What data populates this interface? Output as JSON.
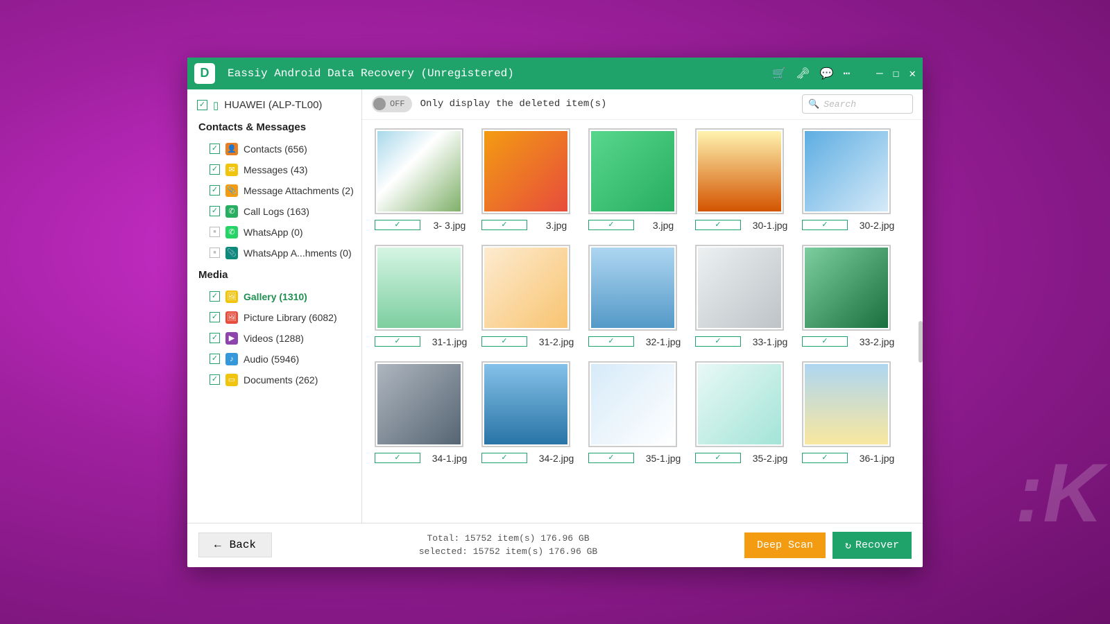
{
  "titlebar": {
    "title": "Eassiy Android Data Recovery (Unregistered)",
    "logo": "D"
  },
  "device": {
    "name": "HUAWEI (ALP-TL00)"
  },
  "sidebar": {
    "group1_title": "Contacts & Messages",
    "group2_title": "Media",
    "items1": [
      {
        "label": "Contacts (656)",
        "color": "#e67e22",
        "glyph": "👤",
        "chk": "checked"
      },
      {
        "label": "Messages (43)",
        "color": "#f1c40f",
        "glyph": "✉",
        "chk": "checked"
      },
      {
        "label": "Message Attachments (2)",
        "color": "#f39c12",
        "glyph": "📎",
        "chk": "checked"
      },
      {
        "label": "Call Logs (163)",
        "color": "#27ae60",
        "glyph": "✆",
        "chk": "checked"
      },
      {
        "label": "WhatsApp (0)",
        "color": "#25d366",
        "glyph": "✆",
        "chk": "gray"
      },
      {
        "label": "WhatsApp A...hments (0)",
        "color": "#0b8a7a",
        "glyph": "📎",
        "chk": "gray"
      }
    ],
    "items2": [
      {
        "label": "Gallery (1310)",
        "color": "#f1c40f",
        "glyph": "🖼",
        "chk": "checked",
        "active": true
      },
      {
        "label": "Picture Library (6082)",
        "color": "#e74c3c",
        "glyph": "🖼",
        "chk": "checked"
      },
      {
        "label": "Videos (1288)",
        "color": "#8e44ad",
        "glyph": "▶",
        "chk": "checked"
      },
      {
        "label": "Audio (5946)",
        "color": "#3498db",
        "glyph": "♪",
        "chk": "checked"
      },
      {
        "label": "Documents (262)",
        "color": "#f1c40f",
        "glyph": "▭",
        "chk": "checked"
      }
    ]
  },
  "toolbar": {
    "toggle_state": "OFF",
    "toggle_label": "Only display the deleted item(s)",
    "search_placeholder": "Search"
  },
  "gallery": [
    {
      "name": "3- 3.jpg",
      "bg": "linear-gradient(135deg,#a8d8ea,#ffffff 40%,#7fb069)"
    },
    {
      "name": "3.jpg",
      "bg": "linear-gradient(135deg,#f39c12,#e74c3c)"
    },
    {
      "name": "3.jpg",
      "bg": "linear-gradient(135deg,#58d68d,#27ae60)"
    },
    {
      "name": "30-1.jpg",
      "bg": "linear-gradient(180deg,#fff3b0,#d35400)"
    },
    {
      "name": "30-2.jpg",
      "bg": "linear-gradient(135deg,#5dade2,#d6eaf8)"
    },
    {
      "name": "31-1.jpg",
      "bg": "linear-gradient(180deg,#d5f5e3,#7dcea0)"
    },
    {
      "name": "31-2.jpg",
      "bg": "linear-gradient(135deg,#fdebd0,#f8c471)"
    },
    {
      "name": "32-1.jpg",
      "bg": "linear-gradient(180deg,#aed6f1,#5499c7)"
    },
    {
      "name": "33-1.jpg",
      "bg": "linear-gradient(135deg,#ecf0f1,#bdc3c7)"
    },
    {
      "name": "33-2.jpg",
      "bg": "linear-gradient(135deg,#7dcea0,#196f3d)"
    },
    {
      "name": "34-1.jpg",
      "bg": "linear-gradient(135deg,#aeb6bf,#566573)"
    },
    {
      "name": "34-2.jpg",
      "bg": "linear-gradient(180deg,#85c1e9,#2874a6)"
    },
    {
      "name": "35-1.jpg",
      "bg": "linear-gradient(135deg,#d6eaf8,#ffffff)"
    },
    {
      "name": "35-2.jpg",
      "bg": "linear-gradient(135deg,#e8f8f5,#a3e4d7)"
    },
    {
      "name": "36-1.jpg",
      "bg": "linear-gradient(180deg,#aed6f1,#f9e79f)"
    }
  ],
  "footer": {
    "back": "Back",
    "total_line": "Total: 15752 item(s) 176.96 GB",
    "selected_line": "selected: 15752 item(s) 176.96 GB",
    "deep_scan": "Deep Scan",
    "recover": "Recover"
  }
}
